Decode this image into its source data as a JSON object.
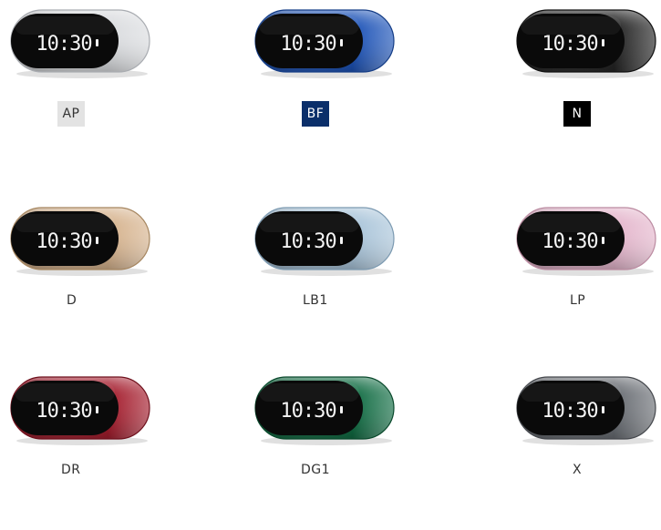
{
  "product_grid": {
    "items": [
      {
        "code": "AP",
        "label_style": "swatch",
        "body_color": "#dadcdf",
        "body_shadow": "#a9acb1",
        "label_bg": "#e3e3e3",
        "label_fg": "#333333",
        "display_text": "10:30"
      },
      {
        "code": "BF",
        "label_style": "swatch",
        "body_color": "#1d53b7",
        "body_shadow": "#153d86",
        "label_bg": "#0b2f6a",
        "label_fg": "#ffffff",
        "display_text": "10:30"
      },
      {
        "code": "N",
        "label_style": "swatch",
        "body_color": "#252525",
        "body_shadow": "#111111",
        "label_bg": "#000000",
        "label_fg": "#ffffff",
        "display_text": "10:30"
      },
      {
        "code": "D",
        "label_style": "plain",
        "body_color": "#d6b38e",
        "body_shadow": "#a68660",
        "label_bg": "#ffffff",
        "label_fg": "#333333",
        "display_text": "10:30"
      },
      {
        "code": "LB1",
        "label_style": "plain",
        "body_color": "#a9c4d9",
        "body_shadow": "#7c9ab1",
        "label_bg": "#ffffff",
        "label_fg": "#333333",
        "display_text": "10:30"
      },
      {
        "code": "LP",
        "label_style": "plain",
        "body_color": "#e4b6cc",
        "body_shadow": "#bb8ba1",
        "label_bg": "#ffffff",
        "label_fg": "#333333",
        "display_text": "10:30"
      },
      {
        "code": "DR",
        "label_style": "plain",
        "body_color": "#a41d2d",
        "body_shadow": "#6f111d",
        "label_bg": "#ffffff",
        "label_fg": "#333333",
        "display_text": "10:30"
      },
      {
        "code": "DG1",
        "label_style": "plain",
        "body_color": "#116c43",
        "body_shadow": "#0b4a2d",
        "label_bg": "#ffffff",
        "label_fg": "#333333",
        "display_text": "10:30"
      },
      {
        "code": "X",
        "label_style": "plain",
        "body_color": "#6a6e74",
        "body_shadow": "#45484d",
        "label_bg": "#ffffff",
        "label_fg": "#333333",
        "display_text": "10:30"
      }
    ]
  }
}
